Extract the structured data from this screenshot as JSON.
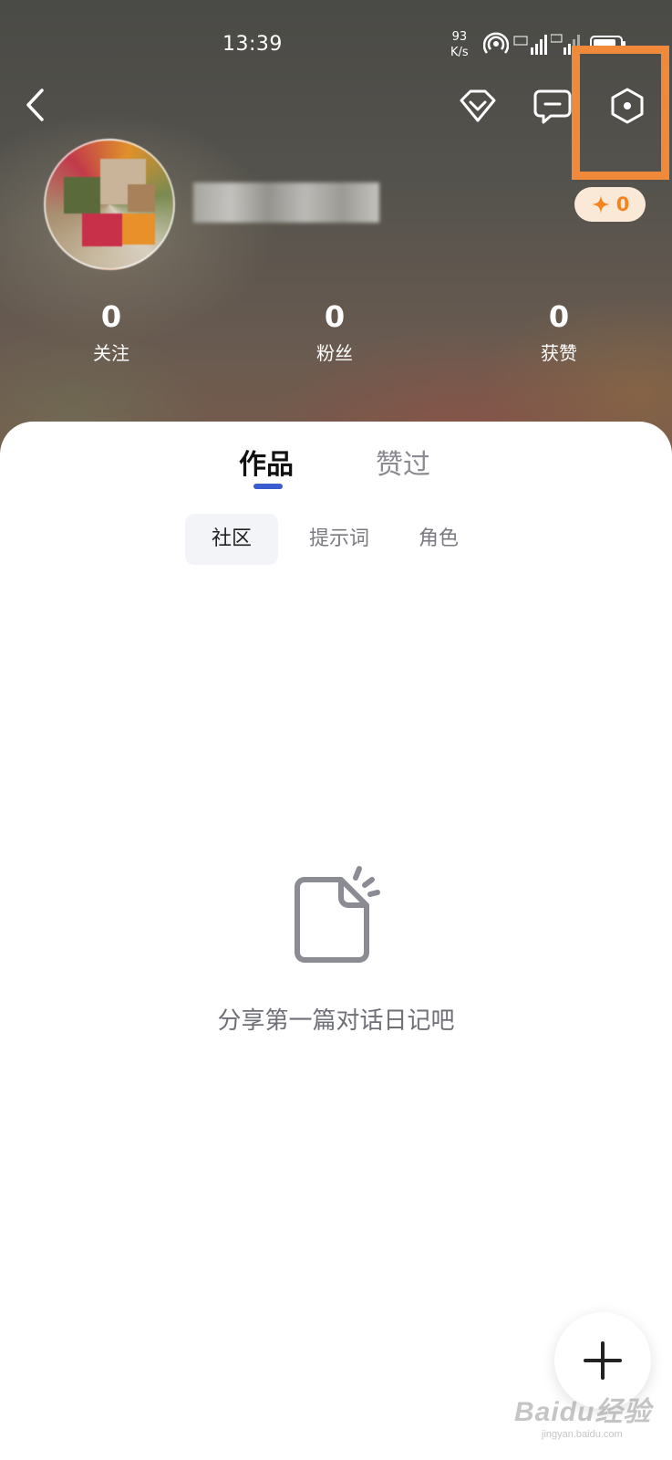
{
  "status_bar": {
    "time": "13:39",
    "net_speed_value": "93",
    "net_speed_unit": "K/s",
    "icons": [
      "hotspot-icon",
      "signal-sim1-icon",
      "signal-sim2-icon",
      "battery-icon"
    ]
  },
  "nav": {
    "back_icon": "chevron-left-icon",
    "actions": [
      "vip-diamond-icon",
      "message-icon",
      "settings-icon"
    ],
    "highlight_color": "#f08a3a"
  },
  "profile": {
    "points_value": "0",
    "points_icon": "sparkle-icon"
  },
  "stats": [
    {
      "value": "0",
      "label": "关注"
    },
    {
      "value": "0",
      "label": "粉丝"
    },
    {
      "value": "0",
      "label": "获赞"
    }
  ],
  "tabs": {
    "main": [
      {
        "label": "作品",
        "active": true
      },
      {
        "label": "赞过",
        "active": false
      }
    ],
    "sub": [
      {
        "label": "社区",
        "active": true
      },
      {
        "label": "提示词",
        "active": false
      },
      {
        "label": "角色",
        "active": false
      }
    ]
  },
  "empty_state": {
    "icon": "document-icon",
    "text": "分享第一篇对话日记吧"
  },
  "fab": {
    "icon": "plus-icon"
  },
  "watermark": {
    "brand": "Baidu经验",
    "url": "jingyan.baidu.com"
  },
  "colors": {
    "accent_indicator": "#3b5ccf",
    "points_text": "#f5841f",
    "points_bg": "#fbe9d8"
  }
}
